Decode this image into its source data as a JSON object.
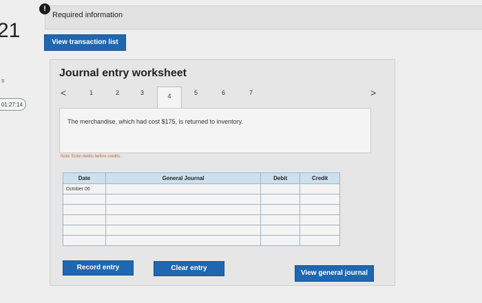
{
  "left": {
    "question_number": "21",
    "timer": "01:27:14"
  },
  "header": {
    "alert_icon": "!",
    "required_label": "Required information",
    "view_transaction_list": "View transaction list"
  },
  "worksheet": {
    "title": "Journal entry worksheet",
    "prev_icon": "<",
    "next_icon": ">",
    "tabs": [
      "1",
      "2",
      "3",
      "4",
      "5",
      "6",
      "7"
    ],
    "active_tab": "4",
    "description": "The merchandise, which had cost $175, is returned to inventory.",
    "note": "Note: Enter debits before credits."
  },
  "table": {
    "headers": {
      "date": "Date",
      "journal": "General Journal",
      "debit": "Debit",
      "credit": "Credit"
    },
    "rows": [
      {
        "date": "October 06",
        "journal": "",
        "debit": "",
        "credit": ""
      },
      {
        "date": "",
        "journal": "",
        "debit": "",
        "credit": ""
      },
      {
        "date": "",
        "journal": "",
        "debit": "",
        "credit": ""
      },
      {
        "date": "",
        "journal": "",
        "debit": "",
        "credit": ""
      },
      {
        "date": "",
        "journal": "",
        "debit": "",
        "credit": ""
      },
      {
        "date": "",
        "journal": "",
        "debit": "",
        "credit": ""
      }
    ]
  },
  "buttons": {
    "record": "Record entry",
    "clear": "Clear entry",
    "general": "View general journal"
  }
}
